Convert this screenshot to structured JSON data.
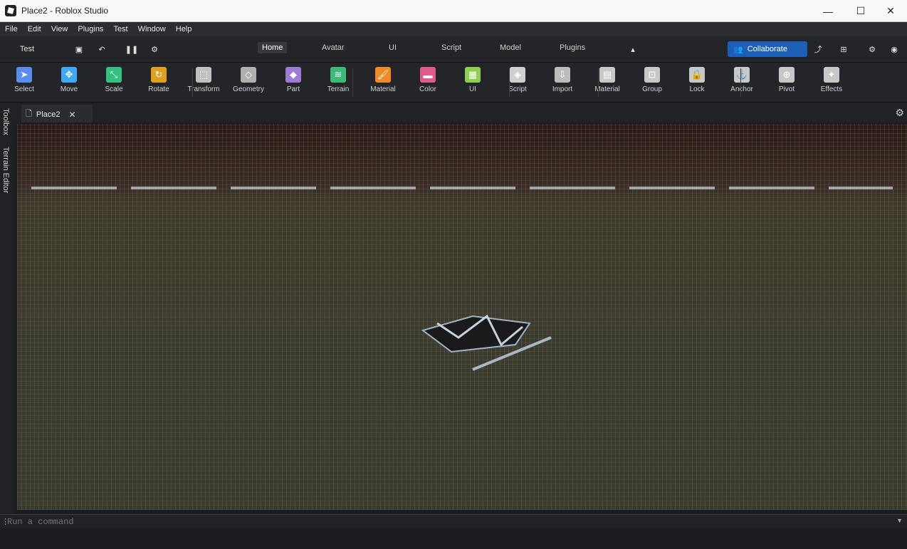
{
  "window": {
    "title": "Place2 - Roblox Studio",
    "controls": {
      "minimize": "—",
      "maximize": "☐",
      "close": "✕"
    }
  },
  "menu": [
    "File",
    "Edit",
    "View",
    "Plugins",
    "Test",
    "Window",
    "Help"
  ],
  "ribbon_tabs": [
    "Home",
    "Avatar",
    "UI",
    "Script",
    "Model",
    "Plugins"
  ],
  "quick_access": {
    "test_label": "Test"
  },
  "collaborate": {
    "label": "Collaborate"
  },
  "tools": [
    {
      "label": "Select",
      "icon": "select-icon",
      "color": "#5b8def"
    },
    {
      "label": "Move",
      "icon": "move-icon",
      "color": "#3fa9f5"
    },
    {
      "label": "Scale",
      "icon": "scale-icon",
      "color": "#34c17e"
    },
    {
      "label": "Rotate",
      "icon": "rotate-icon",
      "color": "#e0a020"
    },
    {
      "label": "Transform",
      "icon": "transform-icon",
      "color": "#c0c0c0"
    },
    {
      "label": "Geometry",
      "icon": "geometry-icon",
      "color": "#b0b0b0"
    },
    {
      "label": "Part",
      "icon": "part-icon",
      "color": "#9e7bd6"
    },
    {
      "label": "Terrain",
      "icon": "terrain-icon",
      "color": "#3dbb78"
    },
    {
      "label": "Material",
      "icon": "material-icon",
      "color": "#f08a24"
    },
    {
      "label": "Color",
      "icon": "color-icon",
      "color": "#e05a8a"
    },
    {
      "label": "UI",
      "icon": "ui-icon",
      "color": "#8fd14f"
    },
    {
      "label": "Script",
      "icon": "script-icon",
      "color": "#cfcfcf"
    },
    {
      "label": "Import",
      "icon": "import-icon",
      "color": "#bcbcbc"
    },
    {
      "label": "Material",
      "icon": "material-manager-icon",
      "color": "#c8c8c8"
    },
    {
      "label": "Group",
      "icon": "group-icon",
      "color": "#c8c8c8"
    },
    {
      "label": "Lock",
      "icon": "lock-icon",
      "color": "#c8c8c8"
    },
    {
      "label": "Anchor",
      "icon": "anchor-icon",
      "color": "#c8c8c8"
    },
    {
      "label": "Pivot",
      "icon": "pivot-icon",
      "color": "#c8c8c8"
    },
    {
      "label": "Effects",
      "icon": "effects-icon",
      "color": "#c8c8c8"
    }
  ],
  "left_panels": [
    "Toolbox",
    "Terrain Editor"
  ],
  "document_tab": {
    "label": "Place2",
    "close": "✕"
  },
  "command_bar": {
    "placeholder": "Run a command"
  }
}
